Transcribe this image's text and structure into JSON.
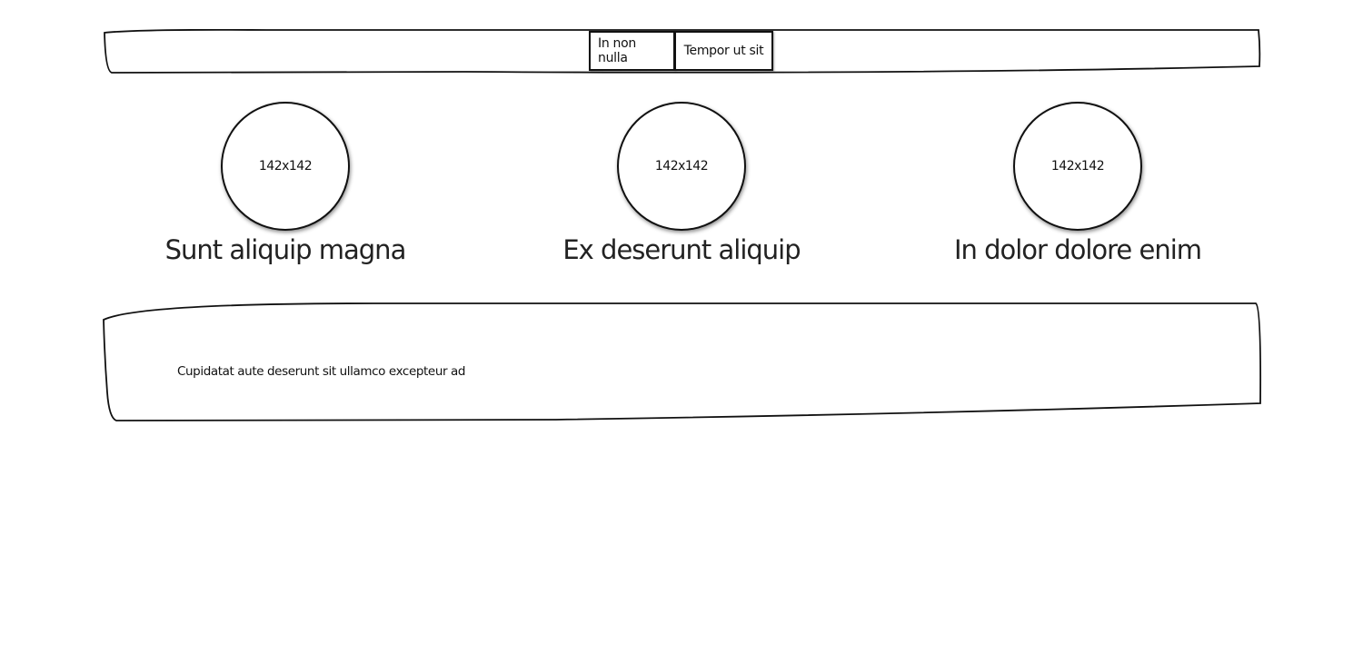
{
  "nav": {
    "buttons": [
      {
        "label": "In non nulla"
      },
      {
        "label": "Tempor ut sit"
      }
    ]
  },
  "features": [
    {
      "image_label": "142x142",
      "title": "Sunt aliquip magna"
    },
    {
      "image_label": "142x142",
      "title": "Ex deserunt aliquip"
    },
    {
      "image_label": "142x142",
      "title": "In dolor dolore enim"
    }
  ],
  "content": {
    "text": "Cupidatat aute deserunt sit ullamco excepteur ad"
  }
}
